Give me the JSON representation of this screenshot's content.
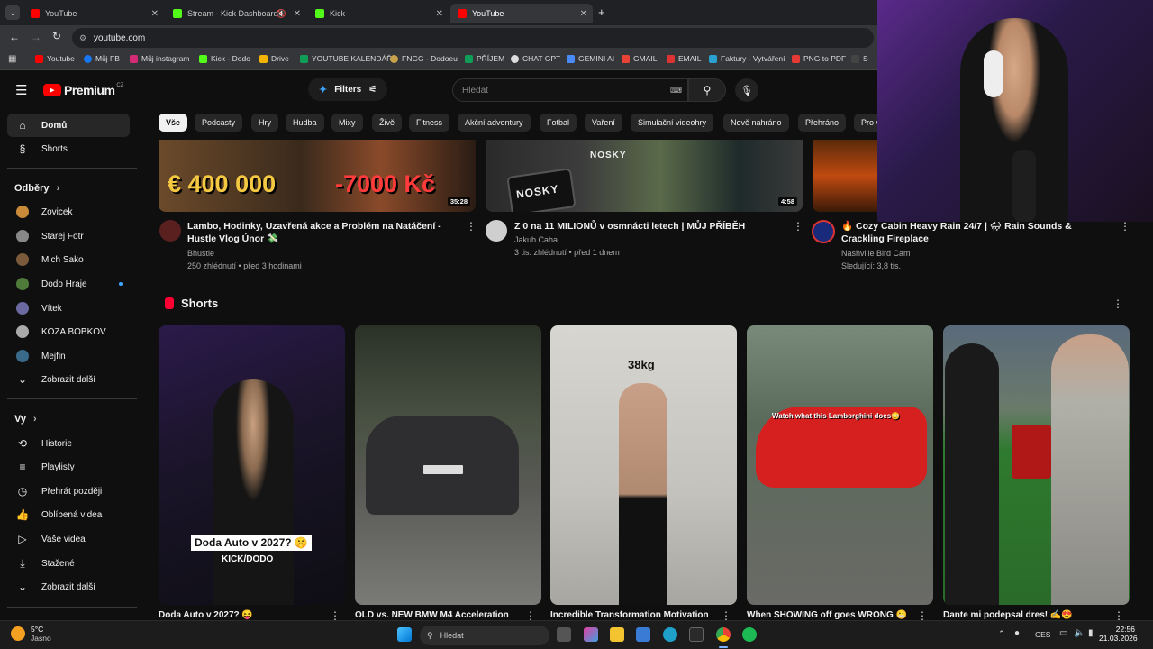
{
  "browser": {
    "tabs": [
      {
        "title": "YouTube",
        "color": "#ff0000"
      },
      {
        "title": "Stream - Kick Dashboard",
        "color": "#53fc18"
      },
      {
        "title": "Kick",
        "color": "#53fc18"
      },
      {
        "title": "YouTube",
        "color": "#ff0000"
      }
    ],
    "url": "youtube.com",
    "bookmarks": [
      "Youtube",
      "Můj FB",
      "Můj instagram",
      "Kick - Dodo",
      "Drive",
      "YOUTUBE KALENDÁŘ",
      "FNGG - Dodoeu",
      "PŘÍJEM",
      "CHAT GPT",
      "GEMINI AI",
      "GMAIL",
      "EMAIL",
      "Faktury - Vytváření",
      "PNG to PDF",
      "S"
    ]
  },
  "youtube": {
    "logo": "Premium",
    "region": "CZ",
    "filters_label": "Filters",
    "search_placeholder": "Hledat",
    "chips": [
      "Vše",
      "Podcasty",
      "Hry",
      "Hudba",
      "Mixy",
      "Živě",
      "Fitness",
      "Akční adventury",
      "Fotbal",
      "Vaření",
      "Simulační videohry",
      "Nově nahráno",
      "Přehráno",
      "Pro v"
    ]
  },
  "sidebar": {
    "main": [
      {
        "label": "Domů",
        "icon": "home-icon"
      },
      {
        "label": "Shorts",
        "icon": "shorts-icon"
      }
    ],
    "subs_header": "Odběry",
    "subs": [
      {
        "label": "Zovicek",
        "color": "#c98b3a"
      },
      {
        "label": "Starej Fotr",
        "color": "#888888"
      },
      {
        "label": "Mich Sako",
        "color": "#7a5a3a"
      },
      {
        "label": "Dodo Hraje",
        "color": "#4e7a3a"
      },
      {
        "label": "Vítek",
        "color": "#6a6aa0"
      },
      {
        "label": "KOZA BOBKOV",
        "color": "#aaaaaa"
      },
      {
        "label": "Mejfin",
        "color": "#3a6a8a"
      }
    ],
    "subs_more": "Zobrazit další",
    "you_header": "Vy",
    "you": [
      {
        "label": "Historie",
        "icon": "history-icon"
      },
      {
        "label": "Playlisty",
        "icon": "playlist-icon"
      },
      {
        "label": "Přehrát později",
        "icon": "watch-later-icon"
      },
      {
        "label": "Oblíbená videa",
        "icon": "like-icon"
      },
      {
        "label": "Vaše videa",
        "icon": "your-videos-icon"
      },
      {
        "label": "Stažené",
        "icon": "download-icon"
      },
      {
        "label": "Zobrazit další",
        "icon": "chevron-down-icon"
      }
    ]
  },
  "videos": [
    {
      "title": "Lambo, Hodinky, Uzavřená akce a Problém na Natáčení - Hustle Vlog Únor 💸",
      "channel": "Bhustle",
      "meta": "250 zhlédnutí • před 3 hodinami",
      "duration": "35:28",
      "thumb_text1": "€ 400 000",
      "thumb_text2": "-7000 Kč"
    },
    {
      "title": "Z 0 na 11 MILIONŮ v osmnácti letech | MŮJ PŘÍBĚH",
      "channel": "Jakub Caha",
      "meta": "3 tis. zhlédnutí • před 1 dnem",
      "duration": "4:58",
      "thumb_text1": "NOSKY",
      "thumb_text2": "NOSKY"
    },
    {
      "title": "🔥 Cozy Cabin Heavy Rain 24/7 | 🌧 Rain Sounds & Crackling Fireplace",
      "channel": "Nashville Bird Cam",
      "meta": "Sledující: 3,8 tis.",
      "duration": "",
      "thumb_text1": "",
      "thumb_text2": ""
    }
  ],
  "shorts_header": "Shorts",
  "shorts": [
    {
      "title": "Doda Auto v 2027? 😝",
      "overlay": "Doda Auto v 2027? 🤫",
      "brand": "KICK/DODO"
    },
    {
      "title": "OLD vs. NEW BMW M4 Acceleration",
      "overlay": "",
      "brand": ""
    },
    {
      "title": "Incredible Transformation Motivation",
      "overlay": "38kg",
      "brand": ""
    },
    {
      "title": "When SHOWING off goes WRONG 😬",
      "overlay": "Watch what this Lamborghini does😳",
      "brand": ""
    },
    {
      "title": "Dante mi podepsal dres! ✍️😍",
      "overlay": "",
      "brand": ""
    }
  ],
  "taskbar": {
    "weather_temp": "5°C",
    "weather_desc": "Jasno",
    "search_placeholder": "Hledat",
    "lang": "CES",
    "time": "22:56",
    "date": "21.03.2026"
  }
}
